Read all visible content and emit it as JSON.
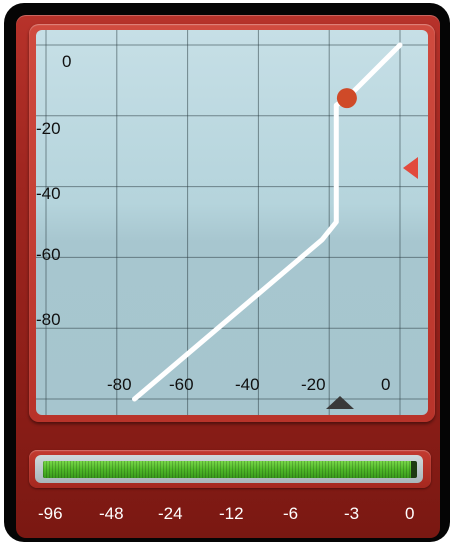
{
  "graph": {
    "y_ticks": [
      "0",
      "-20",
      "-40",
      "-60",
      "-80"
    ],
    "x_ticks": [
      "-80",
      "-60",
      "-40",
      "-20",
      "0"
    ],
    "curve_points": [
      [
        -75,
        -100
      ],
      [
        -22,
        -55
      ],
      [
        -18,
        -50
      ],
      [
        -18,
        -17
      ],
      [
        -15,
        -15
      ],
      [
        0,
        0
      ]
    ],
    "handle_point": [
      -15,
      -15
    ],
    "range": [
      -100,
      0
    ],
    "colors": {
      "curve": "#ffffff",
      "handle": "#cf4a28",
      "grid": "#2c3e44"
    }
  },
  "meter": {
    "scale_labels": [
      "-96",
      "-48",
      "-24",
      "-12",
      "-6",
      "-3",
      "0"
    ],
    "level_fraction": 0.985,
    "colors": {
      "fill": "#4fb828"
    }
  }
}
